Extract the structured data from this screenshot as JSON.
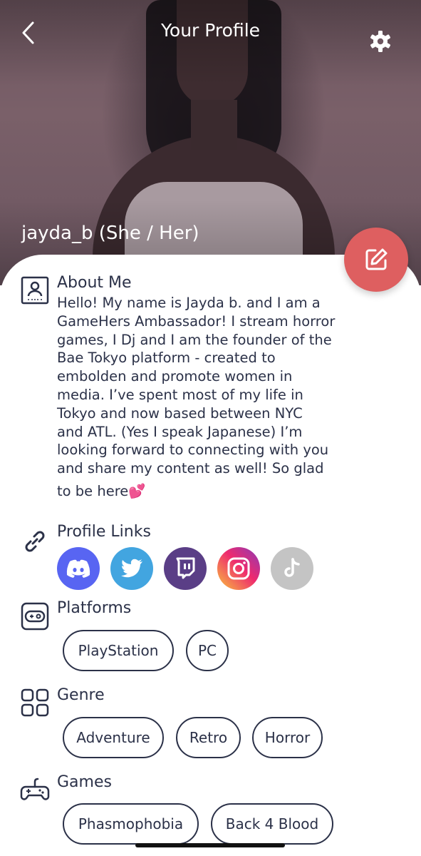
{
  "header": {
    "title": "Your Profile"
  },
  "profile": {
    "username": "jayda_b (She / Her)"
  },
  "about": {
    "title": "About Me",
    "lines": [
      "Hello! My name is Jayda b. and I am a",
      "GameHers Ambassador! I stream horror",
      "games, I Dj and I am the  founder of the",
      "Bae Tokyo platform -  created to",
      "embolden and promote women in",
      "media. I’ve spent most of my life in",
      "Tokyo and now based between NYC",
      "and ATL. (Yes I speak Japanese) I’m",
      "looking forward to connecting with you",
      "and share my content as well! So glad",
      "to be here💕"
    ]
  },
  "links": {
    "title": "Profile Links",
    "items": [
      {
        "icon": "discord-icon",
        "color": "#5865f2"
      },
      {
        "icon": "twitter-icon",
        "color": "#42a5e0"
      },
      {
        "icon": "twitch-icon",
        "color": "#5a3e86"
      },
      {
        "icon": "instagram-icon",
        "color": "#e1306c"
      },
      {
        "icon": "tiktok-icon",
        "color": "#c4c4c4"
      }
    ]
  },
  "platforms": {
    "title": "Platforms",
    "items": [
      "PlayStation",
      "PC"
    ]
  },
  "genre": {
    "title": "Genre",
    "items": [
      "Adventure",
      "Retro",
      "Horror"
    ]
  },
  "games": {
    "title": "Games",
    "items": [
      "Phasmophobia",
      "Back 4 Blood"
    ]
  },
  "colors": {
    "accent": "#de5f60",
    "text": "#2b3148"
  }
}
